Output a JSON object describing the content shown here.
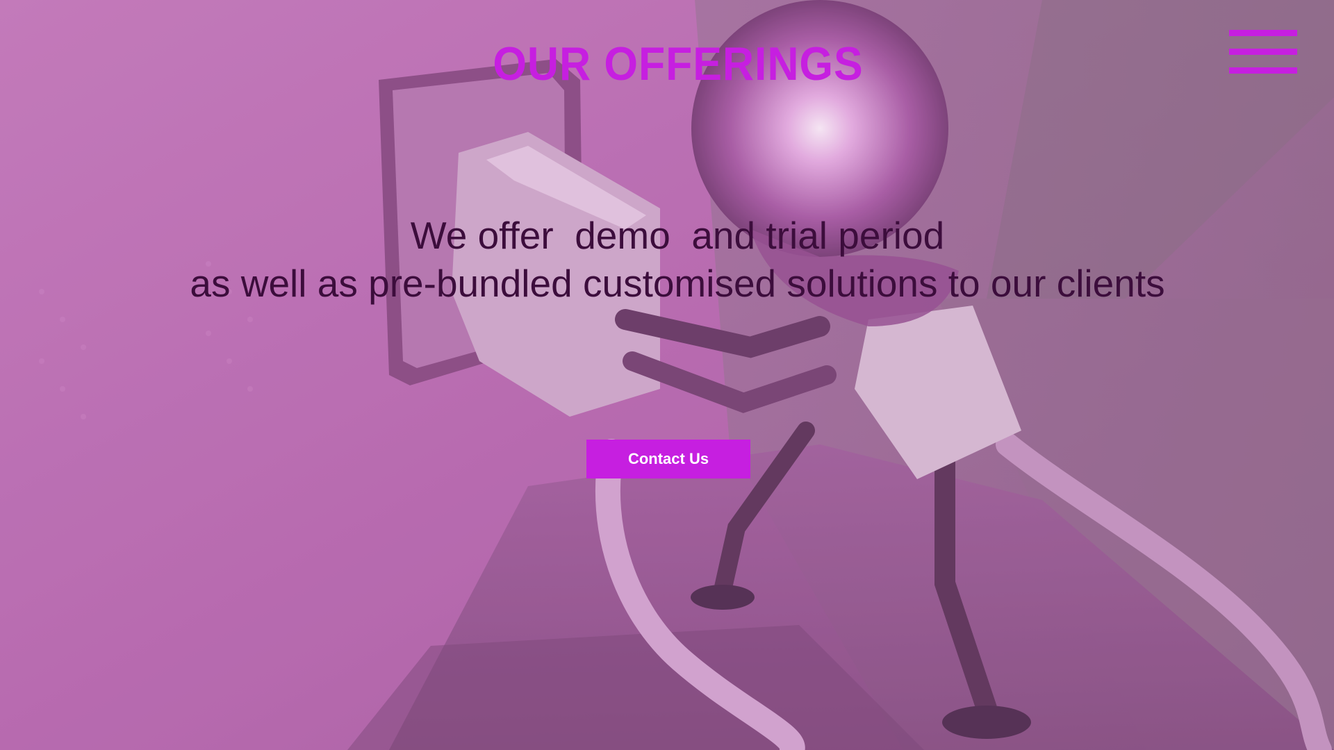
{
  "header": {
    "title": "OUR OFFERINGS",
    "menu_icon": "hamburger-menu-icon"
  },
  "main": {
    "tagline_line1": "We offer  demo  and trial period",
    "tagline_line2": "as well as pre-bundled customised solutions to our clients",
    "contact_label": "Contact Us"
  },
  "colors": {
    "accent": "#c61fe0",
    "tagline_text": "#3c0d3c",
    "button_text": "#ffffff",
    "background_tint": "#b66fb0"
  }
}
